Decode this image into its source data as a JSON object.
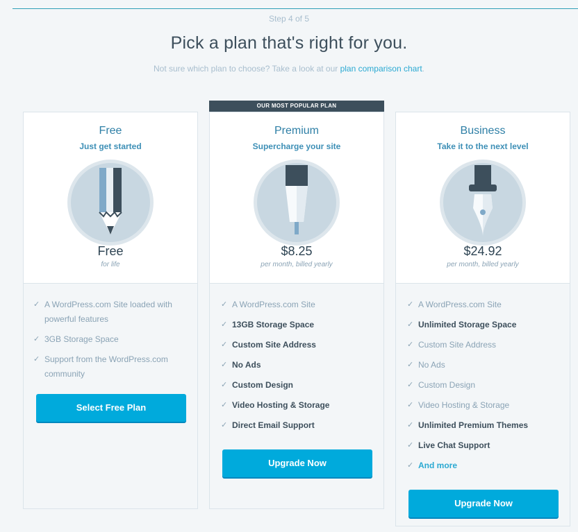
{
  "header": {
    "step": "Step 4 of 5",
    "title": "Pick a plan that's right for you.",
    "subtitle_prefix": "Not sure which plan to choose? Take a look at our ",
    "subtitle_link": "plan comparison chart",
    "subtitle_suffix": "."
  },
  "popular_label": "OUR MOST POPULAR PLAN",
  "colors": {
    "accent": "#00aadc",
    "dark": "#3d4f5c",
    "icon_circle": "#c8d7e1",
    "icon_ring": "#dde6ec"
  },
  "plans": {
    "free": {
      "name": "Free",
      "tagline": "Just get started",
      "icon": "pencil-icon",
      "price": "Free",
      "price_note": "for life",
      "features": [
        "A WordPress.com Site loaded with powerful features",
        "3GB Storage Space",
        "Support from the WordPress.com community"
      ],
      "button": "Select Free Plan"
    },
    "premium": {
      "name": "Premium",
      "tagline": "Supercharge your site",
      "icon": "pen-icon",
      "price": "$8.25",
      "price_note": "per month, billed yearly",
      "features": [
        "A WordPress.com Site",
        "13GB Storage Space",
        "Custom Site Address",
        "No Ads",
        "Custom Design",
        "Video Hosting & Storage",
        "Direct Email Support"
      ],
      "button": "Upgrade Now"
    },
    "business": {
      "name": "Business",
      "tagline": "Take it to the next level",
      "icon": "fountain-pen-icon",
      "price": "$24.92",
      "price_note": "per month, billed yearly",
      "features": [
        "A WordPress.com Site",
        "Unlimited Storage Space",
        "Custom Site Address",
        "No Ads",
        "Custom Design",
        "Video Hosting & Storage",
        "Unlimited Premium Themes",
        "Live Chat Support",
        "And more"
      ],
      "button": "Upgrade Now"
    }
  }
}
